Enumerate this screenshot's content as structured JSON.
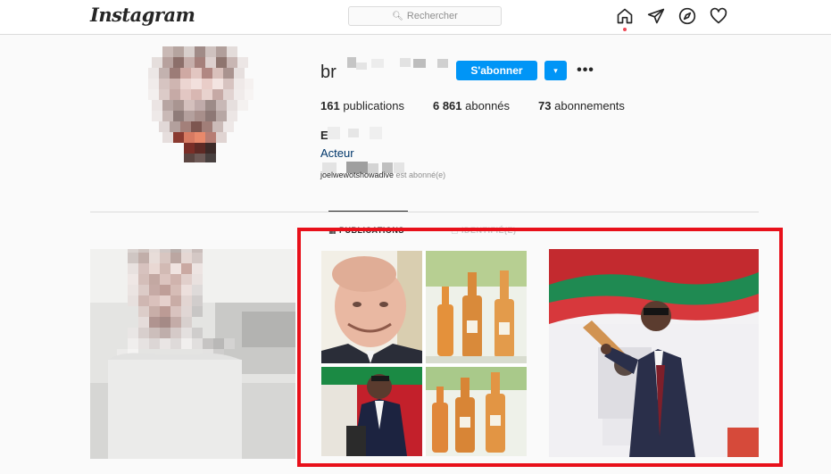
{
  "header": {
    "logo": "Instagram",
    "search_placeholder": "Rechercher",
    "icons": [
      "home-icon",
      "direct-icon",
      "explore-icon",
      "activity-heart-icon"
    ]
  },
  "profile": {
    "username": "br",
    "subscribe_label": "S'abonner",
    "dropdown_glyph": "▾",
    "more_glyph": "•••",
    "stats": {
      "posts_count": "161",
      "posts_label": "publications",
      "followers_count": "6 861",
      "followers_label": "abonnés",
      "following_count": "73",
      "following_label": "abonnements"
    },
    "full_name": "E",
    "category": "Acteur",
    "followed_by_user": "joelwewotshowadive",
    "followed_by_suffix": " est abonné(e)"
  },
  "tabs": {
    "posts_label": "PUBLICATIONS",
    "tagged_label": "IDENTIFIÉ(E)"
  },
  "colors": {
    "accent": "#0095f6",
    "highlight": "#e8101a",
    "notification_dot": "#ed4956"
  }
}
